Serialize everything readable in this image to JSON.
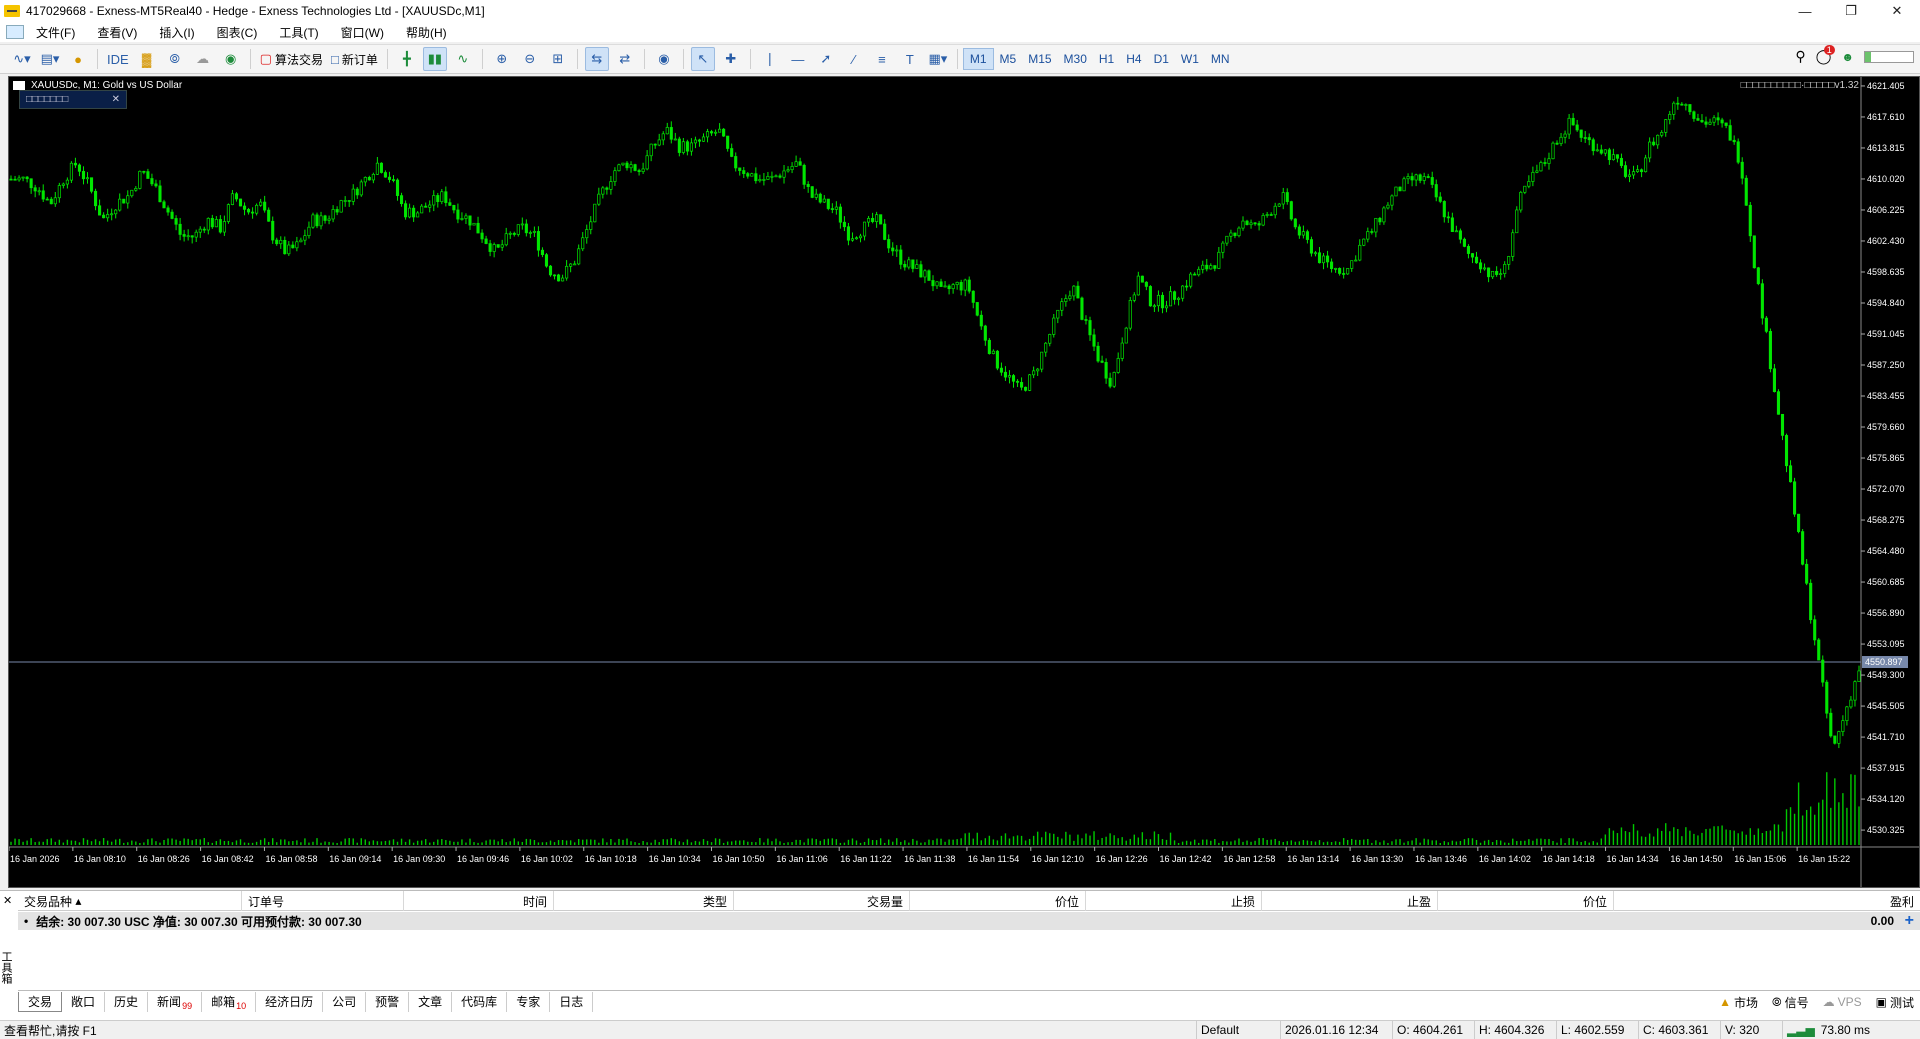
{
  "window": {
    "title": "417029668 - Exness-MT5Real40 - Hedge - Exness Technologies Ltd - [XAUUSDc,M1]"
  },
  "menu": [
    "文件(F)",
    "查看(V)",
    "插入(I)",
    "图表(C)",
    "工具(T)",
    "窗口(W)",
    "帮助(H)"
  ],
  "toolbar": {
    "ide": "IDE",
    "algo": "算法交易",
    "new_order": "新订单",
    "timeframes": [
      "M1",
      "M5",
      "M15",
      "M30",
      "H1",
      "H4",
      "D1",
      "W1",
      "MN"
    ],
    "active_tf": "M1",
    "notif_count": "1"
  },
  "chart": {
    "symbol_title": "XAUUSDc, M1: Gold vs US Dollar",
    "indicator_label": "□□□□□□□□□□·□□□□□v1.32",
    "mini_panel": "□□□□□□□",
    "current_price": "4550.897",
    "y_ticks": [
      "4621.405",
      "4617.610",
      "4613.815",
      "4610.020",
      "4606.225",
      "4602.430",
      "4598.635",
      "4594.840",
      "4591.045",
      "4587.250",
      "4583.455",
      "4579.660",
      "4575.865",
      "4572.070",
      "4568.275",
      "4564.480",
      "4560.685",
      "4556.890",
      "4553.095",
      "4549.300",
      "4545.505",
      "4541.710",
      "4537.915",
      "4534.120",
      "4530.325"
    ],
    "x_ticks": [
      "16 Jan 2026",
      "16 Jan 08:10",
      "16 Jan 08:26",
      "16 Jan 08:42",
      "16 Jan 08:58",
      "16 Jan 09:14",
      "16 Jan 09:30",
      "16 Jan 09:46",
      "16 Jan 10:02",
      "16 Jan 10:18",
      "16 Jan 10:34",
      "16 Jan 10:50",
      "16 Jan 11:06",
      "16 Jan 11:22",
      "16 Jan 11:38",
      "16 Jan 11:54",
      "16 Jan 12:10",
      "16 Jan 12:26",
      "16 Jan 12:42",
      "16 Jan 12:58",
      "16 Jan 13:14",
      "16 Jan 13:30",
      "16 Jan 13:46",
      "16 Jan 14:02",
      "16 Jan 14:18",
      "16 Jan 14:34",
      "16 Jan 14:50",
      "16 Jan 15:06",
      "16 Jan 15:22"
    ]
  },
  "chart_data": {
    "type": "line",
    "title": "XAUUSDc, M1: Gold vs US Dollar",
    "ylim": [
      4528.5,
      4622.5
    ],
    "series": [
      {
        "name": "XAUUSDc",
        "values": [
          4610,
          4610,
          4609,
          4607,
          4610,
          4612,
          4609,
          4605,
          4607,
          4608,
          4611,
          4609,
          4606,
          4603,
          4603,
          4605,
          4604,
          4608,
          4606,
          4607,
          4603,
          4601,
          4602,
          4605,
          4605,
          4607,
          4608,
          4610,
          4612,
          4610,
          4606,
          4606,
          4607,
          4608,
          4606,
          4605,
          4603,
          4601,
          4603,
          4604,
          4603,
          4599,
          4598,
          4600,
          4604,
          4608,
          4611,
          4612,
          4611,
          4614,
          4616,
          4614,
          4614,
          4615,
          4616,
          4612,
          4611,
          4610,
          4610,
          4611,
          4612,
          4608,
          4607,
          4606,
          4603,
          4604,
          4605,
          4602,
          4600,
          4599,
          4598,
          4596,
          4597,
          4597,
          4592,
          4588,
          4586,
          4584,
          4586,
          4590,
          4594,
          4597,
          4592,
          4588,
          4585,
          4592,
          4598,
          4595,
          4595,
          4596,
          4598,
          4599,
          4600,
          4603,
          4605,
          4604,
          4606,
          4608,
          4604,
          4602,
          4600,
          4599,
          4599,
          4602,
          4604,
          4607,
          4609,
          4610,
          4610,
          4607,
          4604,
          4601,
          4600,
          4598,
          4599,
          4607,
          4610,
          4612,
          4615,
          4617,
          4615,
          4614,
          4613,
          4611,
          4610,
          4614,
          4616,
          4620,
          4619,
          4617,
          4617,
          4616,
          4612,
          4600,
          4590,
          4580,
          4570,
          4560,
          4550,
          4540,
          4545,
          4550
        ]
      }
    ]
  },
  "toolbox": {
    "columns": [
      "交易品种",
      "订单号",
      "时间",
      "类型",
      "交易量",
      "价位",
      "止损",
      "止盈",
      "价位",
      "盈利"
    ],
    "balance_text": "结余: 30 007.30 USC  净值: 30 007.30  可用预付款: 30 007.30",
    "profit": "0.00",
    "side_label": "工具箱",
    "tabs": [
      {
        "label": "交易"
      },
      {
        "label": "敞口"
      },
      {
        "label": "历史"
      },
      {
        "label": "新闻",
        "badge": "99"
      },
      {
        "label": "邮箱",
        "badge": "10"
      },
      {
        "label": "经济日历"
      },
      {
        "label": "公司"
      },
      {
        "label": "预警"
      },
      {
        "label": "文章"
      },
      {
        "label": "代码库"
      },
      {
        "label": "专家"
      },
      {
        "label": "日志"
      }
    ],
    "right_items": [
      "市场",
      "信号",
      "VPS",
      "测试"
    ]
  },
  "status": {
    "help": "查看帮忙,请按 F1",
    "profile": "Default",
    "datetime": "2026.01.16 12:34",
    "open": "O: 4604.261",
    "high": "H: 4604.326",
    "low": "L: 4602.559",
    "close": "C: 4603.361",
    "volume": "V: 320",
    "ping": "73.80 ms"
  }
}
